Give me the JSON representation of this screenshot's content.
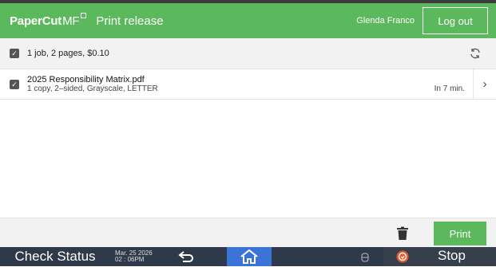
{
  "header": {
    "logo_text": "PaperCut",
    "logo_suffix": "MF",
    "title": "Print release",
    "user": "Glenda Franco",
    "logout_label": "Log out"
  },
  "summary": {
    "text": "1 job, 2 pages, $0.10",
    "checked": true
  },
  "jobs": [
    {
      "name": "2025 Responsibility Matrix.pdf",
      "details": "1 copy, 2–sided, Grayscale, LETTER",
      "time": "In 7 min.",
      "checked": true
    }
  ],
  "footer": {
    "print_label": "Print"
  },
  "system_bar": {
    "check_status": "Check Status",
    "date": "Mar. 25 2026",
    "time": "02 : 06PM",
    "stop_label": "Stop"
  },
  "colors": {
    "brand_green": "#5cb85c",
    "system_bar": "#2e3a4a",
    "home_blue": "#3b74d6",
    "stop_orange": "#e8562a"
  },
  "icons": [
    "checkbox-icon",
    "refresh-icon",
    "chevron-right-icon",
    "trash-icon",
    "back-icon",
    "home-icon",
    "status-icon",
    "stop-icon"
  ]
}
